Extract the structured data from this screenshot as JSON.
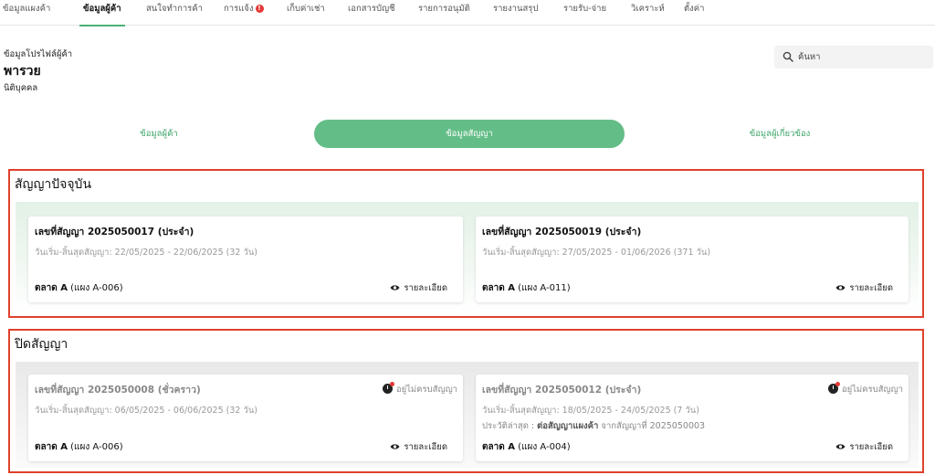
{
  "nav": {
    "tabs": [
      {
        "label": "ข้อมูลแผงค้า"
      },
      {
        "label": "ข้อมูลผู้ค้า"
      },
      {
        "label": "สนใจทำการค้า"
      },
      {
        "label": "การแจ้ง"
      },
      {
        "label": "เก็บค่าเช่า"
      },
      {
        "label": "เอกสารบัญชี"
      },
      {
        "label": "รายการอนุมัติ"
      },
      {
        "label": "รายงานสรุป"
      },
      {
        "label": "รายรับ-จ่าย"
      },
      {
        "label": "วิเคราะห์"
      },
      {
        "label": "ตั้งค่า"
      }
    ],
    "active_tab": "ข้อมูลผู้ค้า",
    "notification_badge": "!",
    "accent_color": "#4caf73",
    "badge_color": "#e53935"
  },
  "profile": {
    "caption": "ข้อมูลโปรไฟล์ผู้ค้า",
    "name": "พารวย",
    "type": "นิติบุคคล"
  },
  "search": {
    "placeholder": "ค้นหา",
    "icon": "search-icon"
  },
  "segments": {
    "items": [
      {
        "label": "ข้อมูลผู้ค้า"
      },
      {
        "label": "ข้อมูลสัญญา"
      },
      {
        "label": "ข้อมูลผู้เกี่ยวข้อง"
      }
    ],
    "active": "ข้อมูลสัญญา",
    "active_color": "#63bd86"
  },
  "current_contracts": {
    "title": "สัญญาปัจจุบัน",
    "cards": [
      {
        "title": "เลขที่สัญญา 2025050017 (ประจำ)",
        "dates": "วันเริ่ม-สิ้นสุดสัญญา: 22/05/2025 - 22/06/2025 (32 วัน)",
        "market": "ตลาด A",
        "stall": "(แผง A-006)",
        "detail_label": "รายละเอียด"
      },
      {
        "title": "เลขที่สัญญา 2025050019 (ประจำ)",
        "dates": "วันเริ่ม-สิ้นสุดสัญญา: 27/05/2025 - 01/06/2026 (371 วัน)",
        "market": "ตลาด A",
        "stall": "(แผง A-011)",
        "detail_label": "รายละเอียด"
      }
    ]
  },
  "closed_contracts": {
    "title": "ปิดสัญญา",
    "cards": [
      {
        "title": "เลขที่สัญญา 2025050008 (ชั่วคราว)",
        "status": "อยู่ไม่ครบสัญญา",
        "dates": "วันเริ่ม-สิ้นสุดสัญญา: 06/05/2025 - 06/06/2025 (32 วัน)",
        "market": "ตลาด A",
        "stall": "(แผง A-006)",
        "detail_label": "รายละเอียด"
      },
      {
        "title": "เลขที่สัญญา 2025050012 (ประจำ)",
        "status": "อยู่ไม่ครบสัญญา",
        "dates": "วันเริ่ม-สิ้นสุดสัญญา: 18/05/2025 - 24/05/2025 (7 วัน)",
        "history_label": "ประวัติล่าสุด :",
        "history_action": "ต่อสัญญาแผงค้า",
        "history_ref": "จากสัญญาที่ 2025050003",
        "market": "ตลาด A",
        "stall": "(แผง A-004)",
        "detail_label": "รายละเอียด"
      }
    ]
  },
  "highlight_color": "#e0412b"
}
